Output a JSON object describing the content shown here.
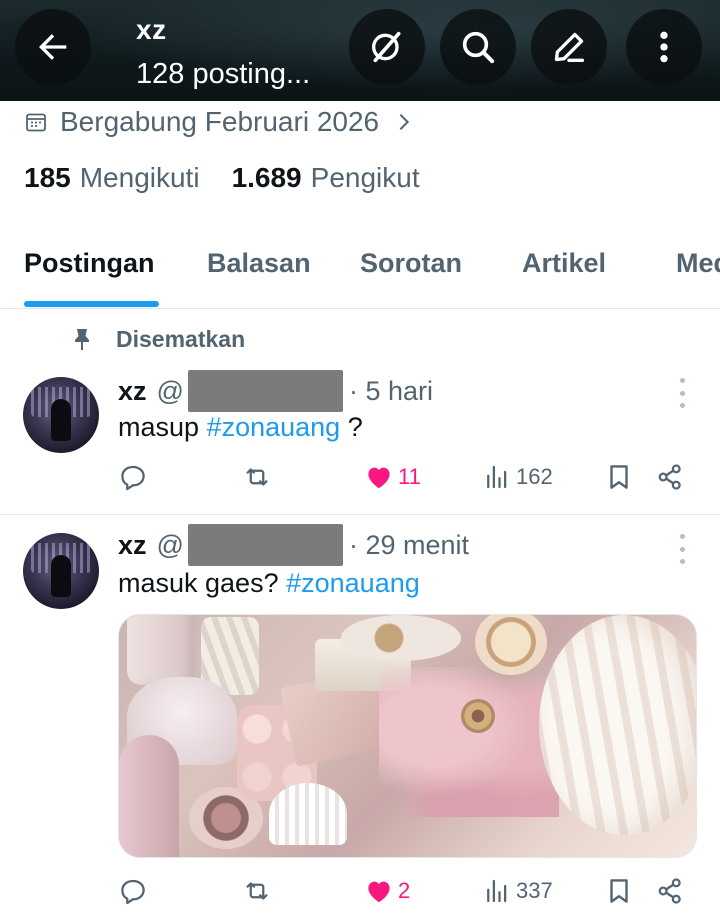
{
  "header": {
    "title": "xz",
    "subtitle": "128 posting..."
  },
  "profile": {
    "joined": "Bergabung Februari 2026",
    "following_count": "185",
    "following_label": "Mengikuti",
    "followers_count": "1.689",
    "followers_label": "Pengikut"
  },
  "tabs": [
    {
      "label": "Postingan",
      "active": true
    },
    {
      "label": "Balasan",
      "active": false
    },
    {
      "label": "Sorotan",
      "active": false
    },
    {
      "label": "Artikel",
      "active": false
    },
    {
      "label": "Media",
      "active": false
    }
  ],
  "pinned_label": "Disematkan",
  "tweets": [
    {
      "name": "xz",
      "handle_prefix": "@",
      "time": "· 5 hari",
      "text": "masup",
      "hashtag": "#zonauang",
      "text_after": "?",
      "likes": "11",
      "views": "162",
      "liked": true
    },
    {
      "name": "xz",
      "handle_prefix": "@",
      "time": "· 29 menit",
      "text": "masuk gaes?",
      "hashtag": "#zonauang",
      "text_after": "",
      "likes": "2",
      "views": "337",
      "liked": true
    }
  ],
  "colors": {
    "accent": "#1d9bf0",
    "like": "#f91880",
    "muted": "#536471",
    "text": "#0f1419"
  }
}
